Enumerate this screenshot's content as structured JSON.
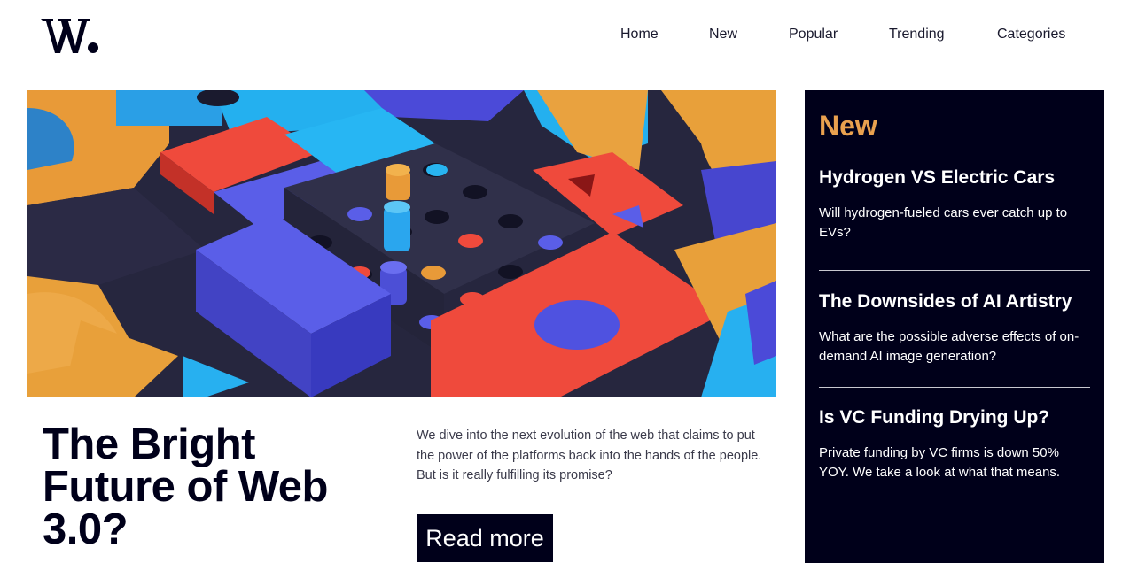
{
  "header": {
    "logo_text": "W.",
    "nav": [
      "Home",
      "New",
      "Popular",
      "Trending",
      "Categories"
    ]
  },
  "hero": {
    "image_description_icon": "abstract-3d-blocks-image"
  },
  "article": {
    "title": "The Bright Future of Web 3.0?",
    "summary": "We dive into the next evolution of the web that claims to put the power of the platforms back into the hands of the people. But is it really fulfilling its promise?",
    "cta_label": "Read more"
  },
  "sidebar": {
    "title": "New",
    "items": [
      {
        "title": "Hydrogen VS Electric Cars",
        "summary": "Will hydrogen-fueled cars ever catch up to EVs?"
      },
      {
        "title": "The Downsides of AI Artistry",
        "summary": "What are the possible adverse effects of on-demand AI image generation?"
      },
      {
        "title": "Is VC Funding Drying Up?",
        "summary": "Private funding by VC firms is down 50% YOY. We take a look at what that means."
      }
    ]
  },
  "colors": {
    "navy": "#00001a",
    "accent": "#e9a14f",
    "red": "#f0473c",
    "blue": "#5057e0",
    "cyan": "#26b2f0"
  }
}
